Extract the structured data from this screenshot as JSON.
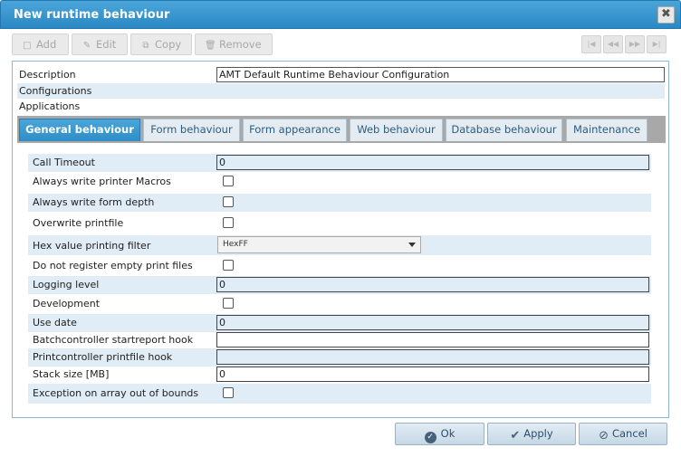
{
  "window": {
    "title": "New runtime behaviour",
    "close_glyph": "✖"
  },
  "toolbar": {
    "add_label": "Add",
    "edit_label": "Edit",
    "copy_label": "Copy",
    "remove_label": "Remove",
    "icons": {
      "add": "square-icon",
      "edit": "pencil-icon",
      "copy": "copy-icon",
      "remove": "trash-icon"
    }
  },
  "record_nav": {
    "first_glyph": "|◀",
    "prev_glyph": "◀◀",
    "next_glyph": "▶▶",
    "last_glyph": "▶|"
  },
  "header_fields": {
    "description_label": "Description",
    "description_value": "AMT Default Runtime Behaviour Configuration",
    "configurations_label": "Configurations",
    "applications_label": "Applications"
  },
  "tabs": [
    {
      "label": "General behaviour",
      "active": true
    },
    {
      "label": "Form behaviour",
      "active": false
    },
    {
      "label": "Form appearance",
      "active": false
    },
    {
      "label": "Web behaviour",
      "active": false
    },
    {
      "label": "Database behaviour",
      "active": false
    },
    {
      "label": "Maintenance",
      "active": false
    }
  ],
  "general": {
    "call_timeout": {
      "label": "Call Timeout",
      "value": "0"
    },
    "always_write_printer_macros": {
      "label": "Always write printer Macros",
      "checked": false
    },
    "always_write_form_depth": {
      "label": "Always write form depth",
      "checked": false
    },
    "overwrite_printfile": {
      "label": "Overwrite printfile",
      "checked": false
    },
    "hex_value_printing_filter": {
      "label": "Hex value printing filter",
      "value": "HexFF"
    },
    "do_not_register_empty_print_files": {
      "label": "Do not register empty print files",
      "checked": false
    },
    "logging_level": {
      "label": "Logging level",
      "value": "0"
    },
    "development": {
      "label": "Development",
      "checked": false
    },
    "use_date": {
      "label": "Use date",
      "value": "0"
    },
    "batchcontroller_startreport_hook": {
      "label": "Batchcontroller startreport hook",
      "value": ""
    },
    "printcontroller_printfile_hook": {
      "label": "Printcontroller printfile hook",
      "value": ""
    },
    "stack_size": {
      "label": "Stack size [MB]",
      "value": "0"
    },
    "exception_on_array_out_of_bounds": {
      "label": "Exception on array out of bounds",
      "checked": false
    }
  },
  "footer": {
    "ok_label": "Ok",
    "apply_label": "Apply",
    "cancel_label": "Cancel",
    "icons": {
      "ok": "check-circle-icon",
      "apply": "checkmark-icon",
      "cancel": "ban-icon"
    }
  },
  "colors": {
    "title_bar": "#2a88c4",
    "active_tab": "#3a9ad0",
    "alt_row": "#e0ecf6",
    "footer_button": "#d2e0ec"
  }
}
